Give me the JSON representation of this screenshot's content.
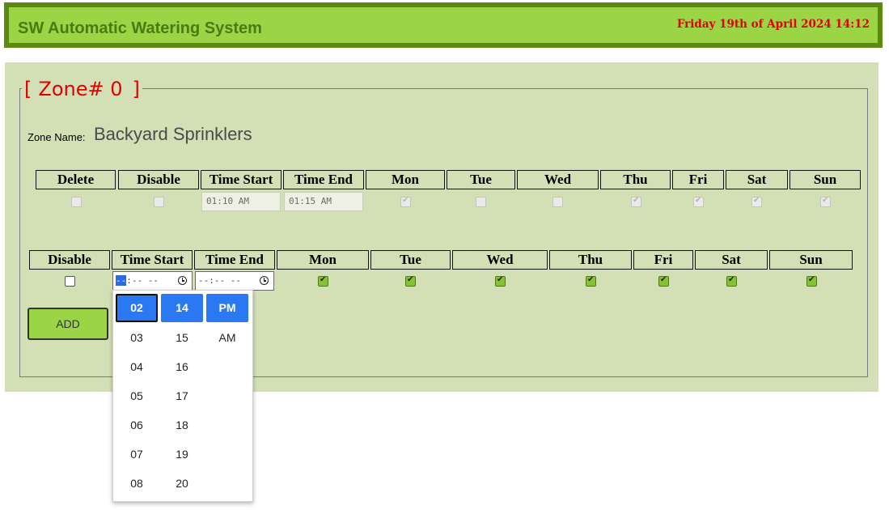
{
  "header": {
    "title": "SW Automatic Watering System",
    "datetime": "Friday 19th of April 2024 14:12"
  },
  "zone": {
    "legend_open": "[",
    "legend_label": "Zone# 0",
    "legend_close": "]",
    "name_label": "Zone Name:",
    "name_value": "Backyard Sprinklers"
  },
  "schedule_table": {
    "headers": [
      "Delete",
      "Disable",
      "Time Start",
      "Time End",
      "Mon",
      "Tue",
      "Wed",
      "Thu",
      "Fri",
      "Sat",
      "Sun"
    ],
    "row": {
      "delete": false,
      "disable": false,
      "time_start": "01:10 AM",
      "time_end": "01:15 AM",
      "days": {
        "Mon": true,
        "Tue": false,
        "Wed": false,
        "Thu": true,
        "Fri": true,
        "Sat": true,
        "Sun": true
      }
    }
  },
  "new_schedule": {
    "headers": [
      "Disable",
      "Time Start",
      "Time End",
      "Mon",
      "Tue",
      "Wed",
      "Thu",
      "Fri",
      "Sat",
      "Sun"
    ],
    "disable": false,
    "time_start_hour_placeholder": "--",
    "time_start_rest": ":-- --",
    "time_end_placeholder": "--:-- --",
    "days": {
      "Mon": true,
      "Tue": true,
      "Wed": true,
      "Thu": true,
      "Fri": true,
      "Sat": true,
      "Sun": true
    }
  },
  "add_button": {
    "label": "ADD"
  },
  "time_picker": {
    "hours": [
      "02",
      "03",
      "04",
      "05",
      "06",
      "07",
      "08"
    ],
    "minutes": [
      "14",
      "15",
      "16",
      "17",
      "18",
      "19",
      "20"
    ],
    "periods": [
      "PM",
      "AM"
    ],
    "selected_hour": "02",
    "selected_minute": "14",
    "selected_period": "PM"
  },
  "colors": {
    "header_bg": "#9bd445",
    "header_border": "#5c8a10",
    "panel_bg": "#d3e0b6",
    "alert_red": "#e00000",
    "picker_selected": "#2b79f2"
  },
  "icons": {
    "time_field": "clock-icon"
  }
}
